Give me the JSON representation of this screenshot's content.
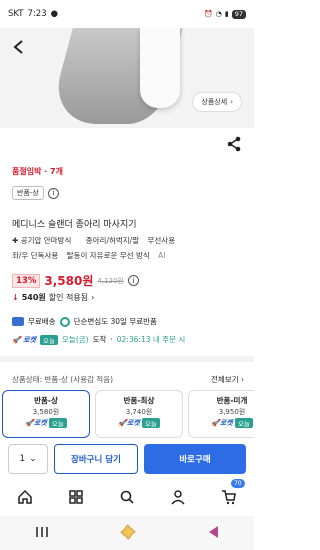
{
  "status_bar": {
    "carrier": "SKT",
    "time": "7:23",
    "battery": "97"
  },
  "hero": {
    "detail_button": "상품상세"
  },
  "product": {
    "sale_tag": "품절임박 · 7개",
    "condition_chip": "반품-상",
    "title": "메디니스 슬랜더 종아리 마사지기",
    "tags": [
      "공기압 안마방식",
      "종아리/허벅지/팔",
      "무선사용",
      "좌/우 단독사용",
      "탈동이 자유로운 무선 방식"
    ],
    "ai_label": "AI",
    "discount": "13%",
    "price": "3,580원",
    "original_price": "4,120원",
    "coupon_amount": "540원",
    "coupon_text": "할인 적용됨"
  },
  "shipping": {
    "free_shipping": "무료배송",
    "free_return": "단순변심도 30일 무료반품",
    "rocket": "로켓",
    "today_badge": "오늘",
    "today": "오늘(금)",
    "arrive": "도착",
    "countdown": "02:36:13 내 주문 시"
  },
  "condition_section": {
    "label": "상품상태: 반품-상 (사용감 적음)",
    "more": "전체보기"
  },
  "options": [
    {
      "grade": "반품-상",
      "price": "3,580원",
      "rocket": "로켓",
      "today": "오늘"
    },
    {
      "grade": "반품-최상",
      "price": "3,740원",
      "rocket": "로켓",
      "today": "오늘"
    },
    {
      "grade": "반품-미개",
      "price": "3,950원",
      "rocket": "로켓",
      "today": "오늘"
    }
  ],
  "purchase_bar": {
    "quantity": "1",
    "cart": "장바구니 담기",
    "buy": "바로구매"
  },
  "app_nav": {
    "cart_count": "70"
  },
  "colors": {
    "accent": "#2e6ce6",
    "price_red": "#d71b2f",
    "today_green": "#2aa090"
  }
}
